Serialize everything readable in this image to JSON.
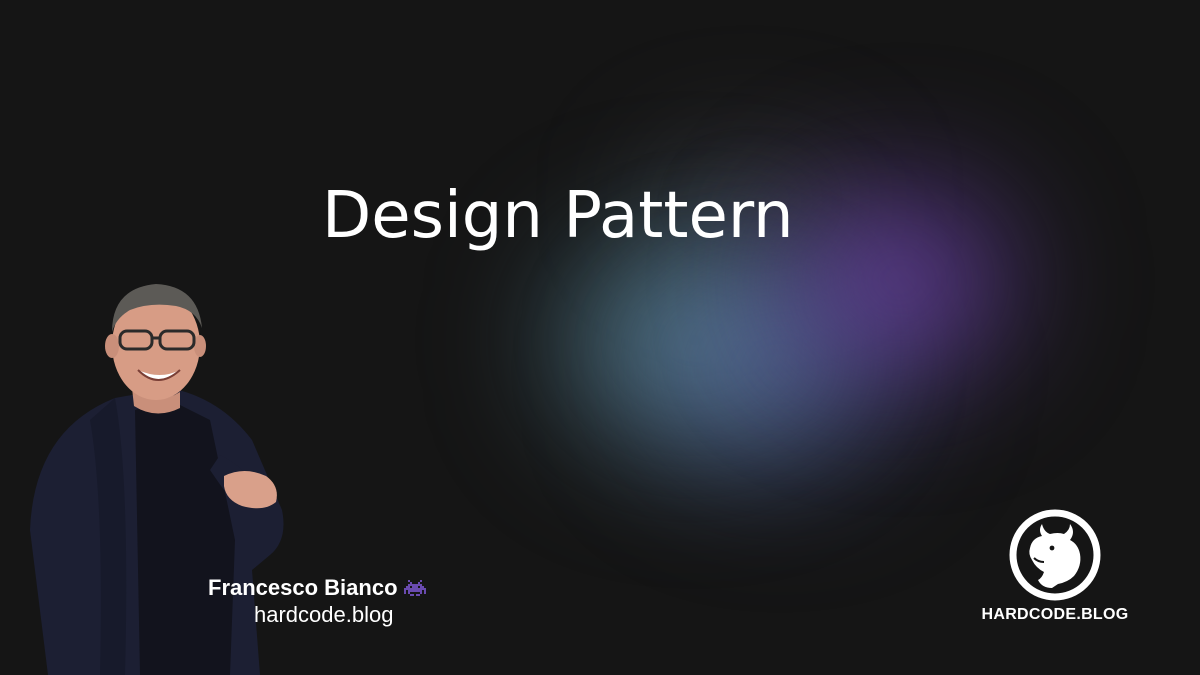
{
  "slide": {
    "title": "Design Pattern",
    "background_color": "#151515",
    "glow_colors": [
      "#70aab0",
      "#6e82c8",
      "#8c50d2"
    ]
  },
  "author": {
    "name": "Francesco Bianco",
    "badge_icon": "alien-monster-icon",
    "badge_color": "#6a4bb0",
    "site": "hardcode.blog"
  },
  "brand": {
    "logo_icon": "bull-head-icon",
    "name": "HARDCODE.BLOG"
  }
}
